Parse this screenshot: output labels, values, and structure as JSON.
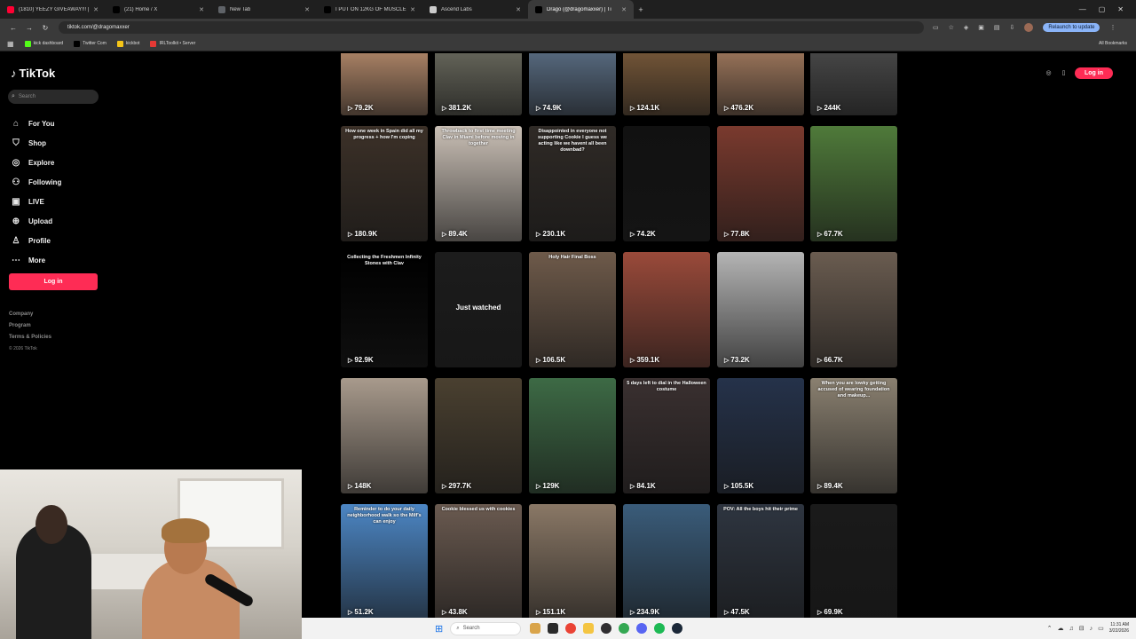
{
  "browser": {
    "tabs": [
      {
        "title": "(1810) YEEZY GIVEAWAY!!! | 67",
        "color": "#ff0033"
      },
      {
        "title": "(21) Home / X",
        "color": "#000000"
      },
      {
        "title": "New Tab",
        "color": "#5f6368"
      },
      {
        "title": "I PUT ON 12KG OF MUSCLE IN",
        "color": "#000000"
      },
      {
        "title": "Ascend Labs",
        "color": "#cccccc"
      },
      {
        "title": "Drago (@dragomaxxer) | Ti",
        "color": "#000000"
      }
    ],
    "url": "tiktok.com/@dragomaxxer",
    "relaunch_label": "Relaunch to update",
    "bookmarks": [
      {
        "label": "kick dashboard",
        "color": "#53fc18"
      },
      {
        "label": "Twitter Com",
        "color": "#000000"
      },
      {
        "label": "kickbot",
        "color": "#f5c518"
      },
      {
        "label": "IRLToolkit • Server",
        "color": "#e53935"
      }
    ],
    "all_bookmarks_label": "All Bookmarks"
  },
  "tiktok": {
    "logo": "TikTok",
    "search_placeholder": "Search",
    "nav": [
      {
        "label": "For You",
        "icon": "home-icon"
      },
      {
        "label": "Shop",
        "icon": "shop-icon"
      },
      {
        "label": "Explore",
        "icon": "explore-icon"
      },
      {
        "label": "Following",
        "icon": "following-icon"
      },
      {
        "label": "LIVE",
        "icon": "live-icon"
      },
      {
        "label": "Upload",
        "icon": "upload-icon"
      },
      {
        "label": "Profile",
        "icon": "profile-icon"
      },
      {
        "label": "More",
        "icon": "more-icon"
      }
    ],
    "login_label": "Log in",
    "footer": [
      "Company",
      "Program",
      "Terms & Policies"
    ],
    "copyright": "© 2026 TikTok",
    "top_login_label": "Log in"
  },
  "videos": [
    {
      "views": "79.2K",
      "caption": "",
      "color": "#b58a6b"
    },
    {
      "views": "381.2K",
      "caption": "",
      "color": "#6a6a5e"
    },
    {
      "views": "74.9K",
      "caption": "",
      "color": "#5b6f86"
    },
    {
      "views": "124.1K",
      "caption": "",
      "color": "#7a5a3a"
    },
    {
      "views": "476.2K",
      "caption": "",
      "color": "#a27a5e"
    },
    {
      "views": "244K",
      "caption": "",
      "color": "#4a4a4a"
    },
    {
      "views": "180.9K",
      "caption": "How one week in Spain did all my progress + how I'm coping",
      "color": "#3c3128"
    },
    {
      "views": "89.4K",
      "caption": "Throwback to first time meeting Clav in Miami before moving in together",
      "color": "#c9bfb5"
    },
    {
      "views": "230.1K",
      "caption": "Disappointed in everyone not supporting Cookie I guess we acting like we havent all been downbad?",
      "color": "#2f2a26"
    },
    {
      "views": "74.2K",
      "caption": "",
      "color": "#111111"
    },
    {
      "views": "77.8K",
      "caption": "",
      "color": "#7a3a2e"
    },
    {
      "views": "67.7K",
      "caption": "",
      "color": "#4f7a3a"
    },
    {
      "views": "92.9K",
      "caption": "Collecting the Freshmen Infinity Stones with Clav",
      "color": "#000000"
    },
    {
      "views": "",
      "caption": "",
      "color": "#1c1c1c",
      "overlay": "Just watched"
    },
    {
      "views": "106.5K",
      "caption": "Holy Hair Final Boss",
      "color": "#6e5a4a"
    },
    {
      "views": "359.1K",
      "caption": "",
      "color": "#9a4a3a"
    },
    {
      "views": "73.2K",
      "caption": "",
      "color": "#b4b4b4"
    },
    {
      "views": "66.7K",
      "caption": "",
      "color": "#6a5c50"
    },
    {
      "views": "148K",
      "caption": "",
      "color": "#a89a8c"
    },
    {
      "views": "297.7K",
      "caption": "",
      "color": "#4a4030"
    },
    {
      "views": "129K",
      "caption": "",
      "color": "#3d6a45"
    },
    {
      "views": "84.1K",
      "caption": "5 days left to dial in the Halloween costume",
      "color": "#3a3030"
    },
    {
      "views": "105.5K",
      "caption": "",
      "color": "#25324a"
    },
    {
      "views": "89.4K",
      "caption": "When you are lowky getting accused of wearing foundation and makeup...",
      "color": "#8a8070"
    },
    {
      "views": "51.2K",
      "caption": "Reminder to do your daily neighborhood walk so the Milf's can enjoy",
      "color": "#4c86c4"
    },
    {
      "views": "43.8K",
      "caption": "Cookie blessed us with cookies",
      "color": "#6a5a50"
    },
    {
      "views": "151.1K",
      "caption": "",
      "color": "#8a7866"
    },
    {
      "views": "234.9K",
      "caption": "",
      "color": "#3a5c7a"
    },
    {
      "views": "47.5K",
      "caption": "POV: All the boys hit their prime",
      "color": "#2e3540"
    },
    {
      "views": "69.9K",
      "caption": "",
      "color": "#1a1a1a"
    }
  ],
  "taskbar": {
    "search_label": "Search",
    "time": "11:31 AM",
    "date": "3/22/2026"
  }
}
